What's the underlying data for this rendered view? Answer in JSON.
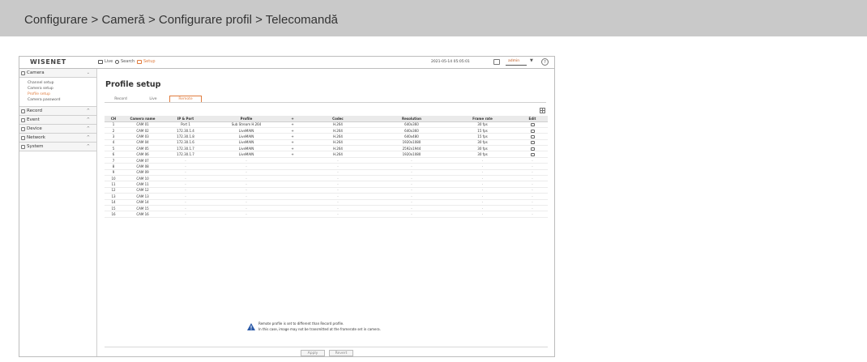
{
  "caption": "Configurare > Cameră > Configurare profil > Telecomandă",
  "topbar": {
    "logo": "WISENET",
    "live_label": "Live",
    "search_label": "Search",
    "setup_label": "Setup",
    "datetime": "2021-05-14 05:05:01",
    "user": "admin",
    "caret": "▼",
    "help": "?"
  },
  "nav": {
    "camera": {
      "label": "Camera",
      "chevron": "⌄",
      "subs": [
        "Channel setup",
        "Camera setup",
        "Profile setup",
        "Camera password"
      ]
    },
    "record": {
      "label": "Record",
      "chevron": "^"
    },
    "event": {
      "label": "Event",
      "chevron": "^"
    },
    "device": {
      "label": "Device",
      "chevron": "^"
    },
    "network": {
      "label": "Network",
      "chevron": "^"
    },
    "system": {
      "label": "System",
      "chevron": "^"
    }
  },
  "page": {
    "title": "Profile setup",
    "tabs": [
      "Record",
      "Live",
      "Remote"
    ],
    "active_tab_index": 2
  },
  "table": {
    "headers": [
      "CH",
      "Camera name",
      "IP & Port",
      "Profile",
      "+",
      "Codec",
      "Resolution",
      "Frame rate",
      "Edit"
    ],
    "rows": [
      [
        "1",
        "CAM 01",
        "Port 1",
        "Sub Stream H.264",
        "+",
        "H.264",
        "640x360",
        "30 fps"
      ],
      [
        "2",
        "CAM 02",
        "172.30.1.4",
        "LiveMAIN",
        "+",
        "H.264",
        "640x360",
        "15 fps"
      ],
      [
        "3",
        "CAM 03",
        "172.30.1.8",
        "LiveMAIN",
        "+",
        "H.264",
        "640x480",
        "15 fps"
      ],
      [
        "4",
        "CAM 04",
        "172.30.1.6",
        "LiveMAIN",
        "+",
        "H.264",
        "1920x1080",
        "30 fps"
      ],
      [
        "5",
        "CAM 05",
        "172.30.1.7",
        "LiveMAIN",
        "+",
        "H.264",
        "2592x1944",
        "30 fps"
      ],
      [
        "6",
        "CAM 06",
        "172.30.1.7",
        "LiveMAIN",
        "+",
        "H.264",
        "1920x1080",
        "30 fps"
      ],
      [
        "7",
        "CAM 07",
        "-",
        "-",
        "",
        "-",
        "-",
        "-"
      ],
      [
        "8",
        "CAM 08",
        "-",
        "-",
        "",
        "-",
        "-",
        "-"
      ],
      [
        "9",
        "CAM 09",
        "-",
        "-",
        "",
        "-",
        "-",
        "-"
      ],
      [
        "10",
        "CAM 10",
        "-",
        "-",
        "",
        "-",
        "-",
        "-"
      ],
      [
        "11",
        "CAM 11",
        "-",
        "-",
        "",
        "-",
        "-",
        "-"
      ],
      [
        "12",
        "CAM 12",
        "-",
        "-",
        "",
        "-",
        "-",
        "-"
      ],
      [
        "13",
        "CAM 13",
        "-",
        "-",
        "",
        "-",
        "-",
        "-"
      ],
      [
        "14",
        "CAM 14",
        "-",
        "-",
        "",
        "-",
        "-",
        "-"
      ],
      [
        "15",
        "CAM 15",
        "-",
        "-",
        "",
        "-",
        "-",
        "-"
      ],
      [
        "16",
        "CAM 16",
        "-",
        "-",
        "",
        "-",
        "-",
        "-"
      ]
    ],
    "empty_edit": "-"
  },
  "warning": {
    "line1": "Remote profile is set to different than Record profile.",
    "line2": "In this case, image may not be transmitted at the framerate set in camera."
  },
  "buttons": {
    "apply": "Apply",
    "revert": "Revert"
  },
  "colors": {
    "accent": "#e07c3e",
    "caption_band": "#c9c9c9"
  }
}
